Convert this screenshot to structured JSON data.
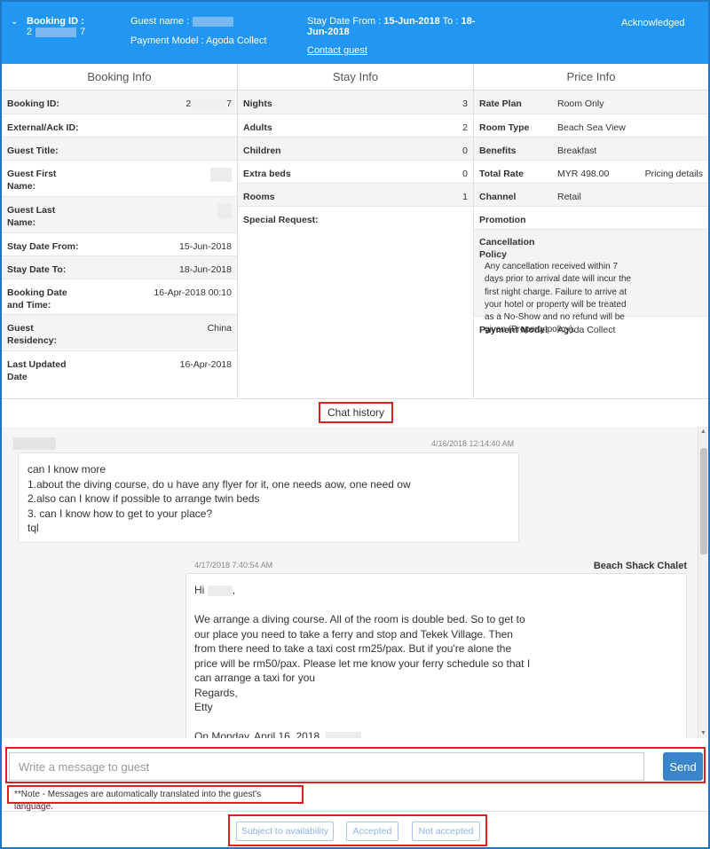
{
  "header": {
    "booking_id_label": "Booking ID :",
    "booking_id_start": "2",
    "booking_id_end": "7",
    "guest_name_label": "Guest name :",
    "payment_model": "Payment Model : Agoda Collect",
    "stay_from_label": "Stay Date From : ",
    "stay_from": "15-Jun-2018",
    "stay_to_label": " To : ",
    "stay_to": "18-Jun-2018",
    "contact_guest": "Contact guest",
    "status": "Acknowledged"
  },
  "booking_info": {
    "title": "Booking Info",
    "booking_id_label": "Booking ID:",
    "booking_id_start": "2",
    "booking_id_end": "7",
    "external_label": "External/Ack ID:",
    "guest_title_label": "Guest Title:",
    "first_name_label": "Guest First Name:",
    "last_name_label": "Guest Last Name:",
    "stay_from_label": "Stay Date From:",
    "stay_from": "15-Jun-2018",
    "stay_to_label": "Stay Date To:",
    "stay_to": "18-Jun-2018",
    "booking_date_label": "Booking Date and Time:",
    "booking_date": "16-Apr-2018 00:10",
    "residency_label": "Guest Residency:",
    "residency": "China",
    "last_updated_label": "Last Updated Date",
    "last_updated": "16-Apr-2018"
  },
  "stay_info": {
    "title": "Stay Info",
    "nights_label": "Nights",
    "nights": "3",
    "adults_label": "Adults",
    "adults": "2",
    "children_label": "Children",
    "children": "0",
    "extra_beds_label": "Extra beds",
    "extra_beds": "0",
    "rooms_label": "Rooms",
    "rooms": "1",
    "special_label": "Special Request:"
  },
  "price_info": {
    "title": "Price Info",
    "rate_plan_label": "Rate Plan",
    "rate_plan": "Room Only",
    "room_type_label": "Room Type",
    "room_type": "Beach Sea View",
    "benefits_label": "Benefits",
    "benefits": "Breakfast",
    "total_rate_label": "Total Rate",
    "total_rate": "MYR 498.00",
    "pricing_details": "Pricing details",
    "channel_label": "Channel",
    "channel": "Retail",
    "promotion_label": "Promotion",
    "cancellation_label": "Cancellation Policy",
    "cancellation": "Any cancellation received within 7 days prior to arrival date will incur the first night charge. Failure to arrive at your hotel or property will be treated as a No-Show and no refund will be given (Property policy).",
    "payment_model_label": "Payment Model",
    "payment_model": "Agoda Collect"
  },
  "chat": {
    "tab_label": "Chat history",
    "msg1_time": "4/16/2018 12:14:40 AM",
    "msg1_lines": [
      "can I know more",
      "1.about the diving course, do u have any flyer for it, one needs aow, one need ow",
      "2.also can I know if possible to arrange twin beds",
      "3. can I know how to get to your place?",
      "tql"
    ],
    "msg2_time": "4/17/2018 7:40:54 AM",
    "msg2_sender": "Beach Shack Chalet",
    "msg2_greeting": "Hi",
    "msg2_body": "We arrange a diving course. All of the room is double bed. So to get to our place you need to take a ferry and stop and Tekek Village. Then from there need to take a taxi cost rm25/pax. But if you're alone the price will be rm50/pax. Please let me know your ferry schedule so that I can arrange a taxi for you",
    "msg2_regards": "Regards,",
    "msg2_sign": "Etty",
    "msg2_quote": "On Monday, April 16, 2018,"
  },
  "compose": {
    "placeholder": "Write a message to guest",
    "send_label": "Send",
    "note": "**Note - Messages are automatically translated into the guest's language."
  },
  "actions": {
    "subject_label": "Subject to availability",
    "accepted_label": "Accepted",
    "not_accepted_label": "Not accepted"
  }
}
